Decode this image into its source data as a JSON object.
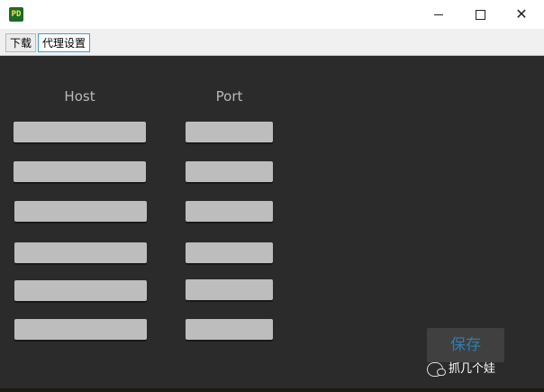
{
  "window": {
    "icon_label": "PD",
    "controls": {
      "minimize": "—",
      "maximize": "□",
      "close": "✕"
    }
  },
  "tabs": [
    {
      "label": "下载"
    },
    {
      "label": "代理设置"
    }
  ],
  "columns": {
    "host": "Host",
    "port": "Port"
  },
  "rows": [
    {
      "host": "",
      "port": ""
    },
    {
      "host": "",
      "port": ""
    },
    {
      "host": "",
      "port": ""
    },
    {
      "host": "",
      "port": ""
    },
    {
      "host": "",
      "port": ""
    },
    {
      "host": "",
      "port": ""
    }
  ],
  "actions": {
    "save": "保存"
  },
  "watermark": {
    "text": "抓几个娃"
  }
}
